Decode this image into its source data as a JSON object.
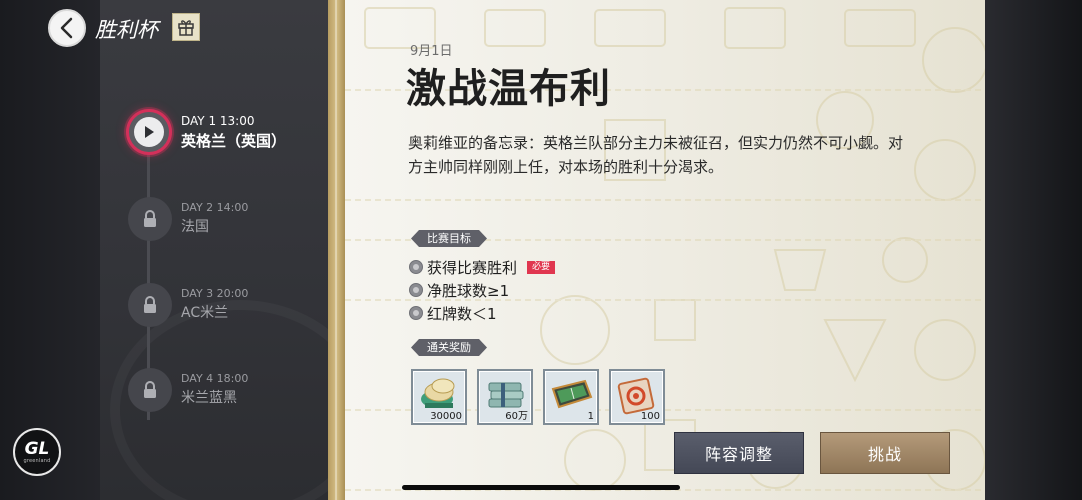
{
  "header": {
    "title": "胜利杯"
  },
  "timeline": {
    "stages": [
      {
        "day": "DAY 1 13:00",
        "name": "英格兰（英国）",
        "status": "active"
      },
      {
        "day": "DAY 2 14:00",
        "name": "法国",
        "status": "locked"
      },
      {
        "day": "DAY 3 20:00",
        "name": "AC米兰",
        "status": "locked"
      },
      {
        "day": "DAY 4 18:00",
        "name": "米兰蓝黑",
        "status": "locked"
      }
    ]
  },
  "logo": {
    "text": "GL",
    "subtext": "greenland"
  },
  "match": {
    "date": "9月1日",
    "title": "激战温布利",
    "description": "奥莉维亚的备忘录：英格兰队部分主力未被征召，但实力仍然不可小觑。对方主帅同样刚刚上任，对本场的胜利十分渴求。"
  },
  "objectives": {
    "label": "比赛目标",
    "items": [
      {
        "text": "获得比赛胜利",
        "badge": "必要"
      },
      {
        "text": "净胜球数≥1"
      },
      {
        "text": "红牌数＜1"
      }
    ]
  },
  "rewards": {
    "label": "通关奖励",
    "items": [
      {
        "icon": "coins-icon",
        "quantity": "30000"
      },
      {
        "icon": "cash-stack-icon",
        "quantity": "60万"
      },
      {
        "icon": "training-board-icon",
        "quantity": "1"
      },
      {
        "icon": "exp-ticket-icon",
        "quantity": "100"
      }
    ]
  },
  "actions": {
    "lineup": "阵容调整",
    "challenge": "挑战"
  },
  "colors": {
    "active_ring": "#d4305a",
    "required_badge": "#e0364f",
    "gold_accent": "#c9b07a"
  }
}
